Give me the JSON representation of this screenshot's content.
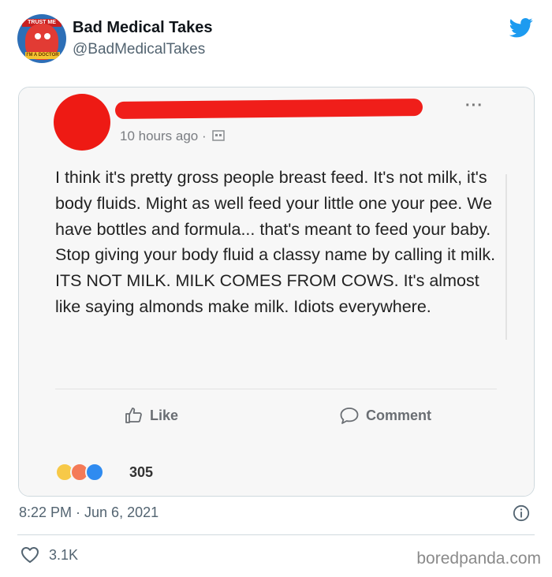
{
  "tweet": {
    "author_name": "Bad Medical Takes",
    "author_handle": "@BadMedicalTakes",
    "avatar_badge_top": "TRUST ME",
    "avatar_badge_bottom": "I'M A DOCTOR",
    "timestamp": "8:22 PM · Jun 6, 2021",
    "likes": "3.1K"
  },
  "fb_post": {
    "time": "10 hours ago ·",
    "menu": "···",
    "body": "I think it's pretty gross people breast feed. It's not milk, it's body fluids. Might as well feed your little one your pee. We have bottles and formula... that's meant to feed your baby. Stop giving your body fluid a classy name by calling it milk. ITS NOT MILK. MILK COMES FROM COWS. It's almost like saying almonds make milk. Idiots everywhere.",
    "like_label": "Like",
    "comment_label": "Comment",
    "reaction_count": "305"
  },
  "watermark": "boredpanda.com",
  "colors": {
    "twitter_blue": "#1d9bf0",
    "redaction": "#f01e1a"
  }
}
